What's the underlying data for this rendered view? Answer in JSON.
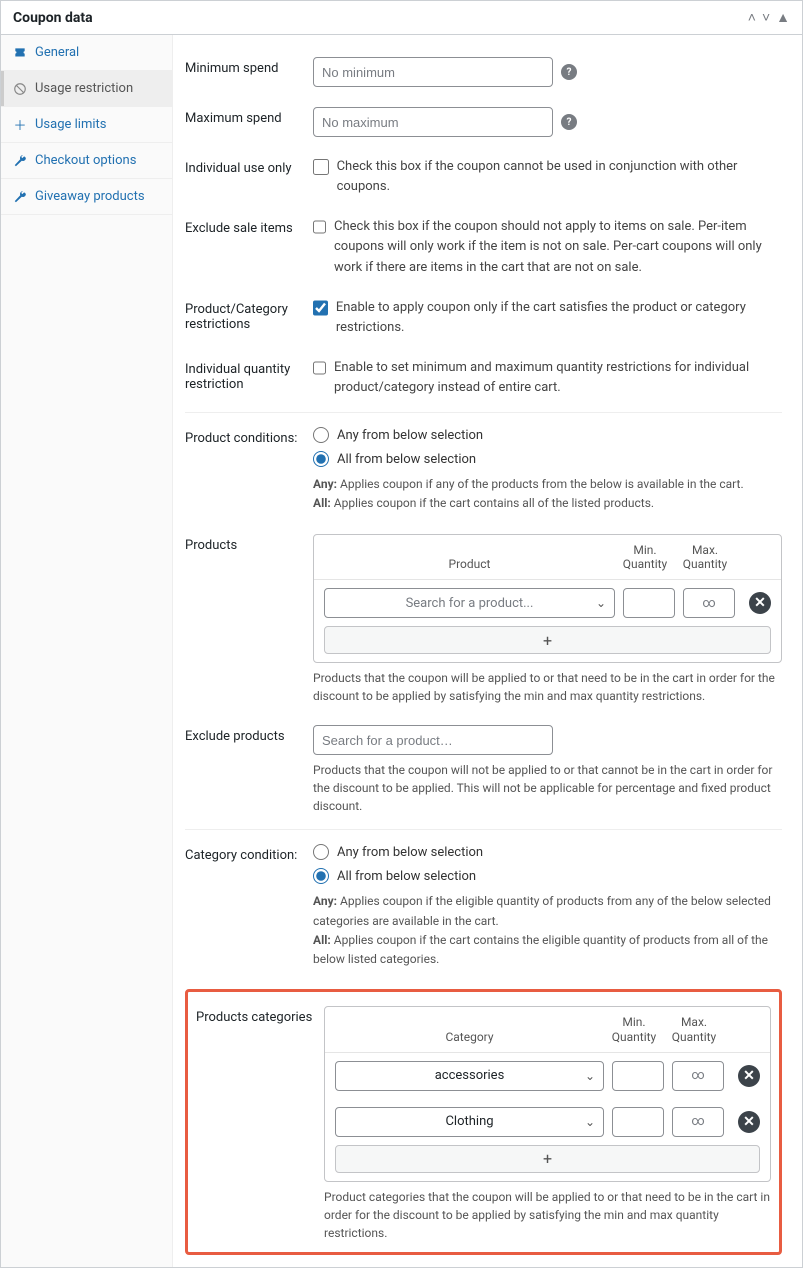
{
  "header": {
    "title": "Coupon data"
  },
  "sidebar": {
    "tabs": [
      {
        "label": "General"
      },
      {
        "label": "Usage restriction"
      },
      {
        "label": "Usage limits"
      },
      {
        "label": "Checkout options"
      },
      {
        "label": "Giveaway products"
      }
    ]
  },
  "fields": {
    "min_spend": {
      "label": "Minimum spend",
      "placeholder": "No minimum"
    },
    "max_spend": {
      "label": "Maximum spend",
      "placeholder": "No maximum"
    },
    "individual_use": {
      "label": "Individual use only",
      "desc": "Check this box if the coupon cannot be used in conjunction with other coupons."
    },
    "exclude_sale": {
      "label": "Exclude sale items",
      "desc": "Check this box if the coupon should not apply to items on sale. Per-item coupons will only work if the item is not on sale. Per-cart coupons will only work if there are items in the cart that are not on sale."
    },
    "prod_cat_restrict": {
      "label": "Product/Category restrictions",
      "desc": "Enable to apply coupon only if the cart satisfies the product or category restrictions."
    },
    "indiv_qty": {
      "label": "Individual quantity restriction",
      "desc": "Enable to set minimum and maximum quantity restrictions for individual product/category instead of entire cart."
    },
    "product_conditions": {
      "label": "Product conditions:",
      "opt_any": "Any from below selection",
      "opt_all": "All from below selection",
      "help_any_label": "Any:",
      "help_any": " Applies coupon if any of the products from the below is available in the cart.",
      "help_all_label": "All:",
      "help_all": " Applies coupon if the cart contains all of the listed products."
    },
    "products": {
      "label": "Products",
      "col_product": "Product",
      "col_min": "Min. Quantity",
      "col_max": "Max. Quantity",
      "placeholder": "Search for a product...",
      "inf": "∞",
      "desc": "Products that the coupon will be applied to or that need to be in the cart in order for the discount to be applied by satisfying the min and max quantity restrictions."
    },
    "exclude_products": {
      "label": "Exclude products",
      "placeholder": "Search for a product…",
      "desc": "Products that the coupon will not be applied to or that cannot be in the cart in order for the discount to be applied. This will not be applicable for percentage and fixed product discount."
    },
    "category_condition": {
      "label": "Category condition:",
      "opt_any": "Any from below selection",
      "opt_all": "All from below selection",
      "help_any_label": "Any:",
      "help_any": " Applies coupon if the eligible quantity of products from any of the below selected categories are available in the cart.",
      "help_all_label": "All:",
      "help_all": " Applies coupon if the cart contains the eligible quantity of products from all of the below listed categories."
    },
    "product_categories": {
      "label": "Products categories",
      "col_category": "Category",
      "col_min": "Min. Quantity",
      "col_max": "Max. Quantity",
      "rows": [
        {
          "name": "accessories"
        },
        {
          "name": "Clothing"
        }
      ],
      "inf": "∞",
      "desc": "Product categories that the coupon will be applied to or that need to be in the cart in order for the discount to be applied by satisfying the min and max quantity restrictions."
    }
  }
}
